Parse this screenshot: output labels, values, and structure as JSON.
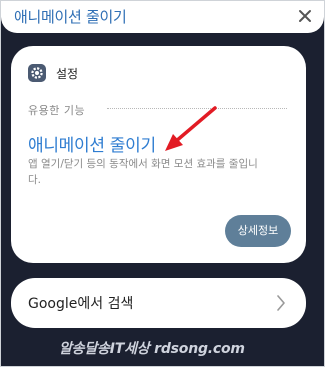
{
  "search": {
    "query": "애니메이션 줄이기",
    "close_icon": "close-icon"
  },
  "result_card": {
    "app_icon": "gear-icon",
    "app_name": "설정",
    "section_label": "유용한 기능",
    "title": "애니메이션 줄이기",
    "description": "앱 열기/닫기 등의 동작에서 화면 모션 효과를 줄입니다.",
    "detail_button": "상세정보"
  },
  "web_search": {
    "label": "Google에서 검색",
    "chevron_icon": "chevron-right-icon"
  },
  "watermark": "알송달송IT세상 rdsong.com",
  "colors": {
    "accent_blue": "#2f7dd1",
    "button": "#5f7f99",
    "annotation_arrow": "#e21b24",
    "background": "#1b2030"
  }
}
